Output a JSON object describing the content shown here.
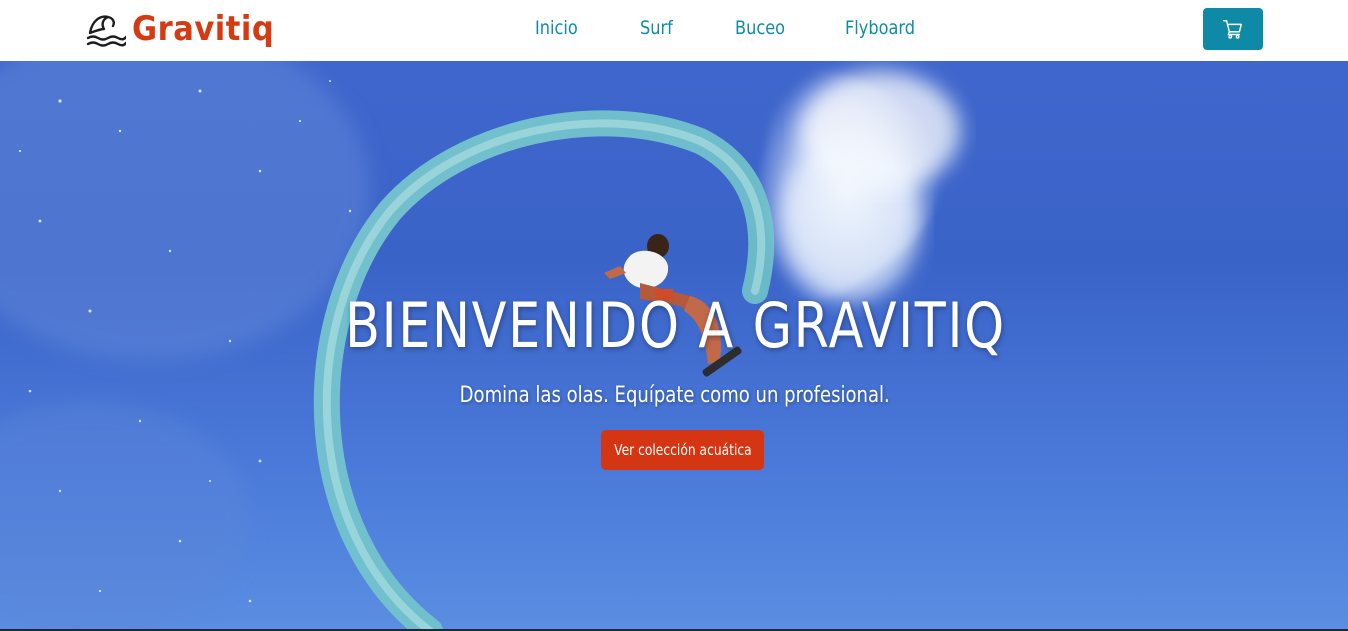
{
  "brand": {
    "name": "Gravitiq",
    "color": "#d63a12",
    "icon": "wave-icon"
  },
  "nav": {
    "items": [
      {
        "label": "Inicio"
      },
      {
        "label": "Surf"
      },
      {
        "label": "Buceo"
      },
      {
        "label": "Flyboard"
      }
    ],
    "color": "#0e8ba7"
  },
  "cart": {
    "icon": "cart-icon",
    "color": "#0f8aa6"
  },
  "hero": {
    "title": "BIENVENIDO A GRAVITIQ",
    "subtitle": "Domina las olas. Equípate como un profesional.",
    "cta_label": "Ver colección acuática",
    "cta_color": "#d43512"
  }
}
